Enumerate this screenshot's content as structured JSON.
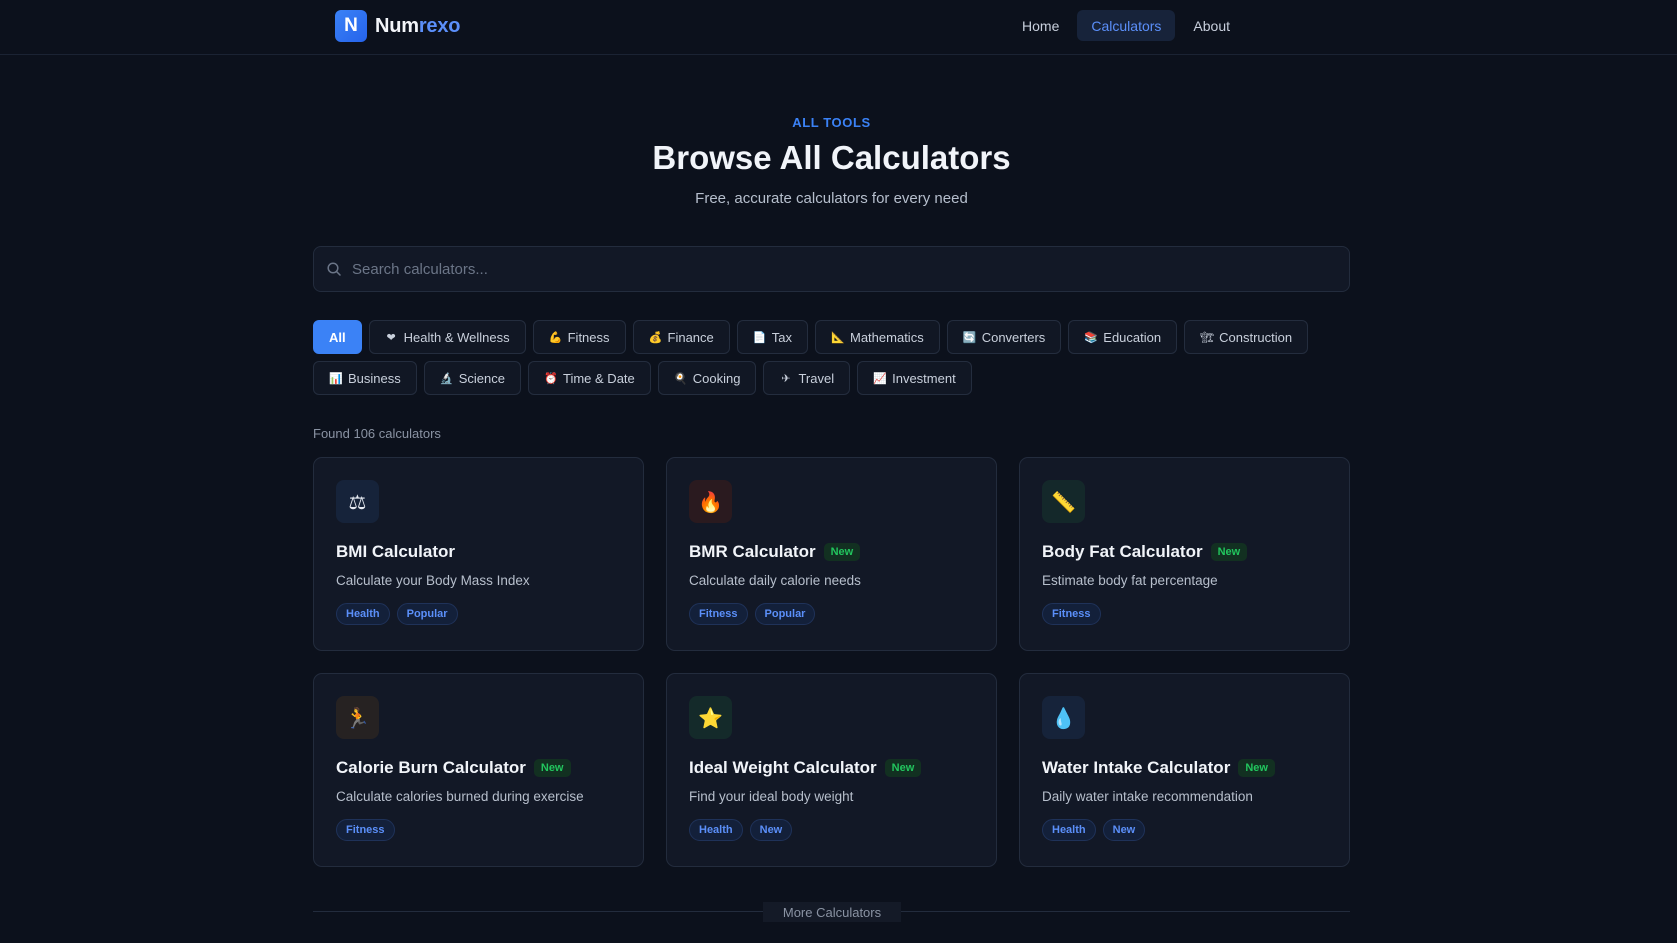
{
  "header": {
    "brand_mark": "N",
    "brand_part1": "Num",
    "brand_part2": "rexo",
    "nav": [
      {
        "label": "Home",
        "active": false
      },
      {
        "label": "Calculators",
        "active": true
      },
      {
        "label": "About",
        "active": false
      }
    ]
  },
  "hero": {
    "eyebrow": "ALL TOOLS",
    "title": "Browse All Calculators",
    "subtitle": "Free, accurate calculators for every need"
  },
  "search": {
    "placeholder": "Search calculators...",
    "icon": "search-icon"
  },
  "categories": [
    {
      "label": "All",
      "emoji": "",
      "active": true
    },
    {
      "label": "Health & Wellness",
      "emoji": "❤",
      "active": false
    },
    {
      "label": "Fitness",
      "emoji": "💪",
      "active": false
    },
    {
      "label": "Finance",
      "emoji": "💰",
      "active": false
    },
    {
      "label": "Tax",
      "emoji": "📄",
      "active": false
    },
    {
      "label": "Mathematics",
      "emoji": "📐",
      "active": false
    },
    {
      "label": "Converters",
      "emoji": "🔄",
      "active": false
    },
    {
      "label": "Education",
      "emoji": "📚",
      "active": false
    },
    {
      "label": "Construction",
      "emoji": "🏗",
      "active": false
    },
    {
      "label": "Business",
      "emoji": "📊",
      "active": false
    },
    {
      "label": "Science",
      "emoji": "🔬",
      "active": false
    },
    {
      "label": "Time & Date",
      "emoji": "⏰",
      "active": false
    },
    {
      "label": "Cooking",
      "emoji": "🍳",
      "active": false
    },
    {
      "label": "Travel",
      "emoji": "✈",
      "active": false
    },
    {
      "label": "Investment",
      "emoji": "📈",
      "active": false
    }
  ],
  "found_text": "Found 106 calculators",
  "new_label": "New",
  "cards": [
    {
      "title": "BMI Calculator",
      "desc": "Calculate your Body Mass Index",
      "icon": "⚖",
      "icon_name": "scale-icon",
      "icon_bg": "#16233a",
      "is_new": false,
      "tags": [
        "Health",
        "Popular"
      ]
    },
    {
      "title": "BMR Calculator",
      "desc": "Calculate daily calorie needs",
      "icon": "🔥",
      "icon_name": "fire-icon",
      "icon_bg": "#2a1a1f",
      "is_new": true,
      "tags": [
        "Fitness",
        "Popular"
      ]
    },
    {
      "title": "Body Fat Calculator",
      "desc": "Estimate body fat percentage",
      "icon": "📏",
      "icon_name": "ruler-icon",
      "icon_bg": "#14282a",
      "is_new": true,
      "tags": [
        "Fitness"
      ]
    },
    {
      "title": "Calorie Burn Calculator",
      "desc": "Calculate calories burned during exercise",
      "icon": "🏃",
      "icon_name": "runner-icon",
      "icon_bg": "#262222",
      "is_new": true,
      "tags": [
        "Fitness"
      ]
    },
    {
      "title": "Ideal Weight Calculator",
      "desc": "Find your ideal body weight",
      "icon": "⭐",
      "icon_name": "star-icon",
      "icon_bg": "#142a2a",
      "is_new": true,
      "tags": [
        "Health",
        "New"
      ]
    },
    {
      "title": "Water Intake Calculator",
      "desc": "Daily water intake recommendation",
      "icon": "💧",
      "icon_name": "droplet-icon",
      "icon_bg": "#16233a",
      "is_new": true,
      "tags": [
        "Health",
        "New"
      ]
    }
  ],
  "more_label": "More Calculators",
  "colors": {
    "accent": "#3b82f6",
    "new_green": "#22c55e",
    "background": "#0c111c",
    "card": "#121826"
  }
}
